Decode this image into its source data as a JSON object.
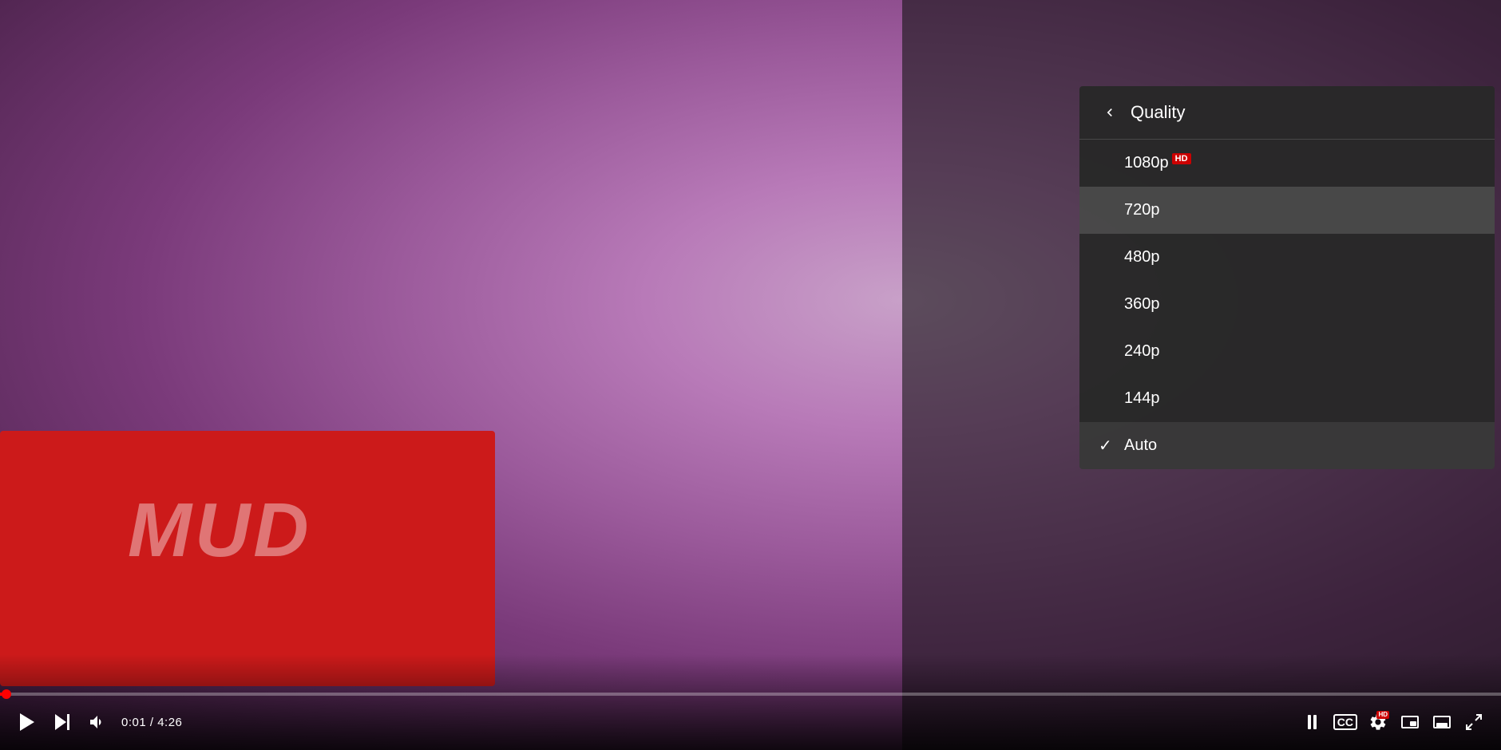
{
  "video": {
    "bg_color_from": "#c8a0c8",
    "bg_color_to": "#3a1a3a"
  },
  "controls": {
    "play_button_label": "▶",
    "next_button_label": "⏭",
    "volume_button_label": "🔊",
    "time_current": "0:01",
    "time_total": "4:26",
    "time_separator": "/",
    "time_display": "0:01 / 4:26",
    "cc_label": "CC",
    "settings_label": "⚙",
    "miniplayer_label": "⧉",
    "theater_label": "▬",
    "fullscreen_label": "⛶"
  },
  "quality_menu": {
    "back_label": "‹",
    "title": "Quality",
    "options": [
      {
        "id": "1080p",
        "label": "1080p",
        "badge": "HD",
        "selected": false,
        "highlighted": false
      },
      {
        "id": "720p",
        "label": "720p",
        "badge": null,
        "selected": false,
        "highlighted": true
      },
      {
        "id": "480p",
        "label": "480p",
        "badge": null,
        "selected": false,
        "highlighted": false
      },
      {
        "id": "360p",
        "label": "360p",
        "badge": null,
        "selected": false,
        "highlighted": false
      },
      {
        "id": "240p",
        "label": "240p",
        "badge": null,
        "selected": false,
        "highlighted": false
      },
      {
        "id": "144p",
        "label": "144p",
        "badge": null,
        "selected": false,
        "highlighted": false
      },
      {
        "id": "auto",
        "label": "Auto",
        "badge": null,
        "selected": true,
        "highlighted": false
      }
    ]
  },
  "mud_text": "MUD",
  "progress_percent": 0.4
}
